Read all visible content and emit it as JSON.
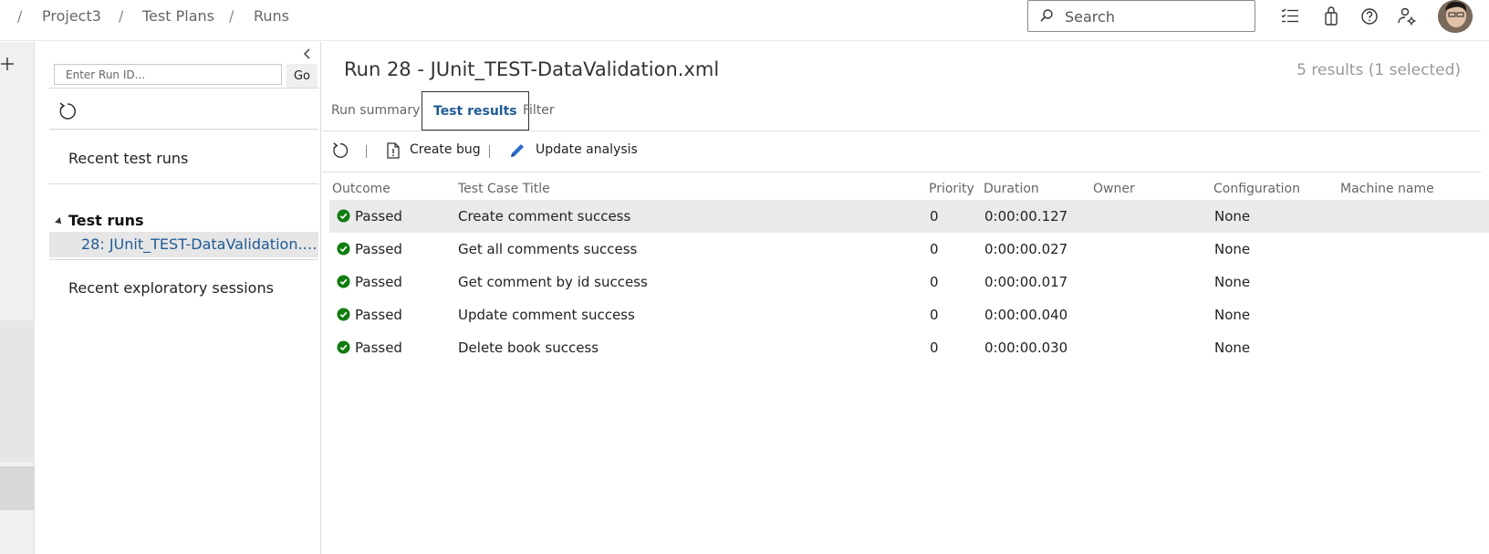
{
  "breadcrumb": {
    "separator": "/",
    "project": "Project3",
    "section": "Test Plans",
    "page": "Runs"
  },
  "search": {
    "placeholder": "Search"
  },
  "top_icons": [
    "task-list-icon",
    "shopping-bag-icon",
    "help-icon",
    "user-settings-icon"
  ],
  "left_panel": {
    "run_id_placeholder": "Enter Run ID...",
    "go_label": "Go",
    "recent_test_runs": "Recent test runs",
    "test_runs_group": "Test runs",
    "selected_run": "28: JUnit_TEST-DataValidation.xml",
    "recent_exploratory": "Recent exploratory sessions"
  },
  "main": {
    "run_title": "Run 28 - JUnit_TEST-DataValidation.xml",
    "results_count": "5 results (1 selected)",
    "tabs": [
      {
        "label": "Run summary",
        "active": false
      },
      {
        "label": "Test results",
        "active": true
      },
      {
        "label": "Filter",
        "active": false
      }
    ],
    "toolbar": {
      "create_bug": "Create bug",
      "update_analysis": "Update analysis"
    },
    "columns": [
      "Outcome",
      "Test Case Title",
      "Priority",
      "Duration",
      "Owner",
      "Configuration",
      "Machine name"
    ],
    "rows": [
      {
        "outcome": "Passed",
        "title": "Create comment success",
        "priority": "0",
        "duration": "0:00:00.127",
        "owner": "",
        "configuration": "None",
        "machine": "",
        "selected": true
      },
      {
        "outcome": "Passed",
        "title": "Get all comments success",
        "priority": "0",
        "duration": "0:00:00.027",
        "owner": "",
        "configuration": "None",
        "machine": "",
        "selected": false
      },
      {
        "outcome": "Passed",
        "title": "Get comment by id success",
        "priority": "0",
        "duration": "0:00:00.017",
        "owner": "",
        "configuration": "None",
        "machine": "",
        "selected": false
      },
      {
        "outcome": "Passed",
        "title": "Update comment success",
        "priority": "0",
        "duration": "0:00:00.040",
        "owner": "",
        "configuration": "None",
        "machine": "",
        "selected": false
      },
      {
        "outcome": "Passed",
        "title": "Delete book success",
        "priority": "0",
        "duration": "0:00:00.030",
        "owner": "",
        "configuration": "None",
        "machine": "",
        "selected": false
      }
    ]
  },
  "colors": {
    "passed_green": "#107c10",
    "link_blue": "#1f5b94",
    "selected_row": "#eaeaea",
    "update_icon_blue": "#2b6cc4"
  }
}
